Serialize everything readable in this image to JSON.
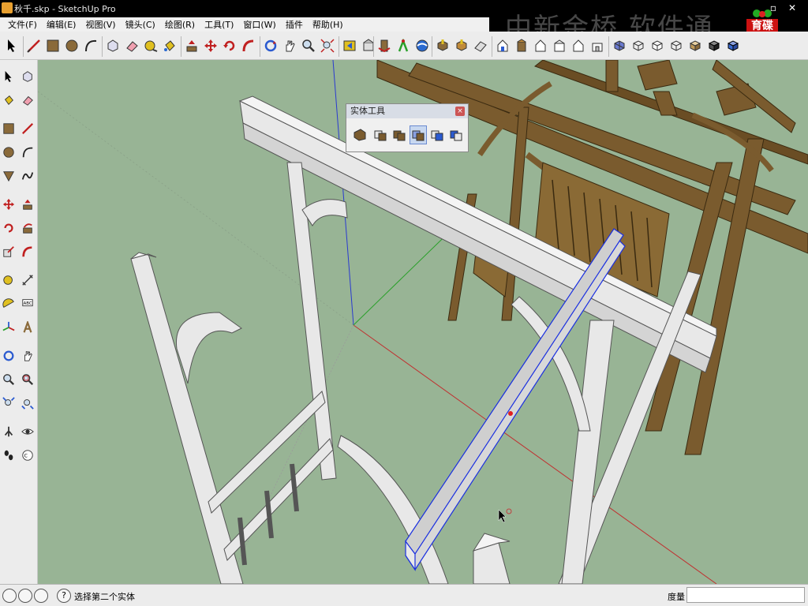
{
  "window": {
    "title": "秋千.skp - SketchUp Pro",
    "controls": [
      "▫",
      "✕"
    ]
  },
  "watermark": {
    "text": "中新金桥 软件通"
  },
  "logo": {
    "text": "育碟软件"
  },
  "menu": {
    "items": [
      "文件(F)",
      "编辑(E)",
      "视图(V)",
      "镜头(C)",
      "绘图(R)",
      "工具(T)",
      "窗口(W)",
      "插件",
      "帮助(H)"
    ]
  },
  "toolbar_top": {
    "tools": [
      "select-icon",
      "line-icon",
      "rectangle-icon",
      "circle-icon",
      "arc-icon",
      "make-component-icon",
      "eraser-icon",
      "tape-measure-icon",
      "paint-bucket-icon",
      "push-pull-icon",
      "move-icon",
      "rotate-icon",
      "follow-me-icon",
      "scale-icon",
      "offset-icon",
      "orbit-icon",
      "pan-icon",
      "zoom-icon",
      "zoom-extents-icon",
      "previous-view-icon",
      "next-view-icon",
      "position-camera-icon",
      "walk-icon",
      "look-around-icon",
      "section-plane-icon",
      "iso-view-icon",
      "top-view-icon",
      "front-view-icon",
      "right-view-icon",
      "back-view-icon",
      "left-view-icon",
      "xray-icon",
      "wireframe-icon",
      "hidden-line-icon",
      "shaded-icon",
      "shaded-texture-icon",
      "monochrome-icon"
    ]
  },
  "toolbar_left": {
    "tools": [
      "select-icon",
      "make-component-icon",
      "paint-bucket-icon",
      "eraser-icon",
      "rectangle-icon",
      "line-icon",
      "circle-icon",
      "arc-icon",
      "polygon-icon",
      "freehand-icon",
      "move-icon",
      "push-pull-icon",
      "rotate-icon",
      "follow-me-icon",
      "scale-icon",
      "offset-icon",
      "tape-measure-icon",
      "dimension-icon",
      "protractor-icon",
      "text-icon",
      "axes-icon",
      "3d-text-icon",
      "orbit-icon",
      "pan-icon",
      "zoom-icon",
      "zoom-window-icon",
      "zoom-extents-icon",
      "previous-icon",
      "position-camera-icon",
      "look-around-icon",
      "walk-icon",
      "section-plane-icon"
    ]
  },
  "solid_tools_panel": {
    "title": "实体工具",
    "close": "×",
    "tools": [
      "outer-shell-icon",
      "intersect-icon",
      "union-icon",
      "subtract-icon",
      "trim-icon",
      "split-icon"
    ]
  },
  "statusbar": {
    "hint": "选择第二个实体",
    "measure_label": "度量",
    "measure_value": "",
    "icons": [
      "geo-location-icon",
      "credits-icon",
      "user-icon",
      "help-icon"
    ]
  },
  "colors": {
    "viewport_bg": "#98b495",
    "wood": "#7a5b2e",
    "white_parts": "#e8e8e8",
    "selection_blue": "#1a2fe0",
    "accent_red": "#cc1111"
  }
}
